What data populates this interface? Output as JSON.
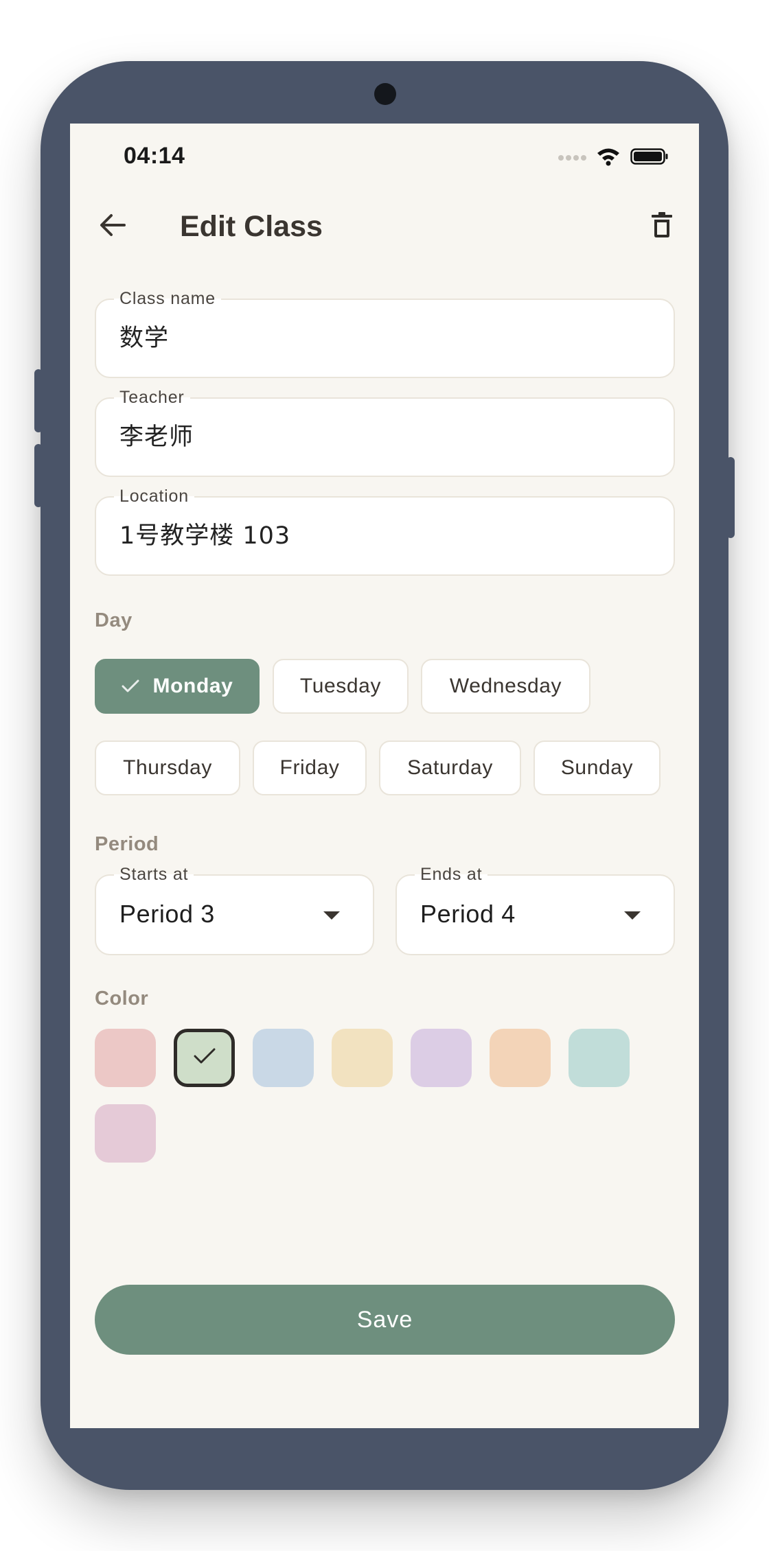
{
  "status_bar": {
    "time": "04:14"
  },
  "app_bar": {
    "title": "Edit Class",
    "back_icon": "arrow-left-icon",
    "delete_icon": "trash-icon"
  },
  "form": {
    "class_name": {
      "label": "Class name",
      "value": "数学"
    },
    "teacher": {
      "label": "Teacher",
      "value": "李老师"
    },
    "location": {
      "label": "Location",
      "value": "1号教学楼 103"
    }
  },
  "day": {
    "label": "Day",
    "options": [
      "Monday",
      "Tuesday",
      "Wednesday",
      "Thursday",
      "Friday",
      "Saturday",
      "Sunday"
    ],
    "selected": "Monday"
  },
  "period": {
    "label": "Period",
    "starts": {
      "label": "Starts at",
      "value": "Period 3"
    },
    "ends": {
      "label": "Ends at",
      "value": "Period 4"
    }
  },
  "color": {
    "label": "Color",
    "swatches": [
      "#ecc8c6",
      "#cfdec9",
      "#c9d8e6",
      "#f2e2c0",
      "#dccde5",
      "#f3d4b8",
      "#c1ddd9",
      "#e5cad7"
    ],
    "selected_index": 1
  },
  "save_label": "Save",
  "theme": {
    "accent": "#6e8f7e",
    "background": "#f8f6f1",
    "frame": "#4a5468"
  }
}
